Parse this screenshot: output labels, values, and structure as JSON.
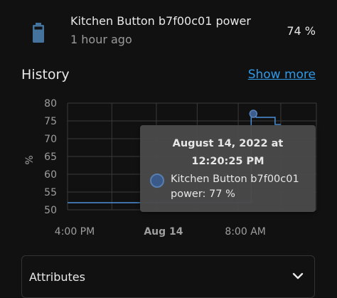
{
  "entity": {
    "name": "Kitchen Button b7f00c01 power",
    "last_changed": "1 hour ago",
    "state": "74 %",
    "icon": "battery-icon",
    "icon_color": "#44739e"
  },
  "history": {
    "title": "History",
    "show_more": "Show more"
  },
  "chart_data": {
    "type": "line",
    "ylabel": "%",
    "ylim": [
      50,
      80
    ],
    "yticks": [
      "50",
      "55",
      "60",
      "65",
      "70",
      "75",
      "80"
    ],
    "xticks": [
      {
        "label": "4:00 PM",
        "bold": false
      },
      {
        "label": "Aug 14",
        "bold": true
      },
      {
        "label": "8:00 AM",
        "bold": false
      }
    ],
    "grid": true,
    "line_color": "#4a90d9",
    "series": [
      {
        "x": [
          0.0,
          0.738,
          0.738,
          0.758,
          0.758,
          0.834,
          0.834,
          0.857
        ],
        "values": [
          52,
          52,
          77,
          77,
          76,
          76,
          74,
          74
        ]
      }
    ],
    "highlight_index": 3
  },
  "tooltip": {
    "title": "August 14, 2022 at 12:20:25 PM",
    "series_label": "Kitchen Button b7f00c01 power: 77 %"
  },
  "attributes": {
    "label": "Attributes",
    "icon": "chevron-down-icon"
  }
}
